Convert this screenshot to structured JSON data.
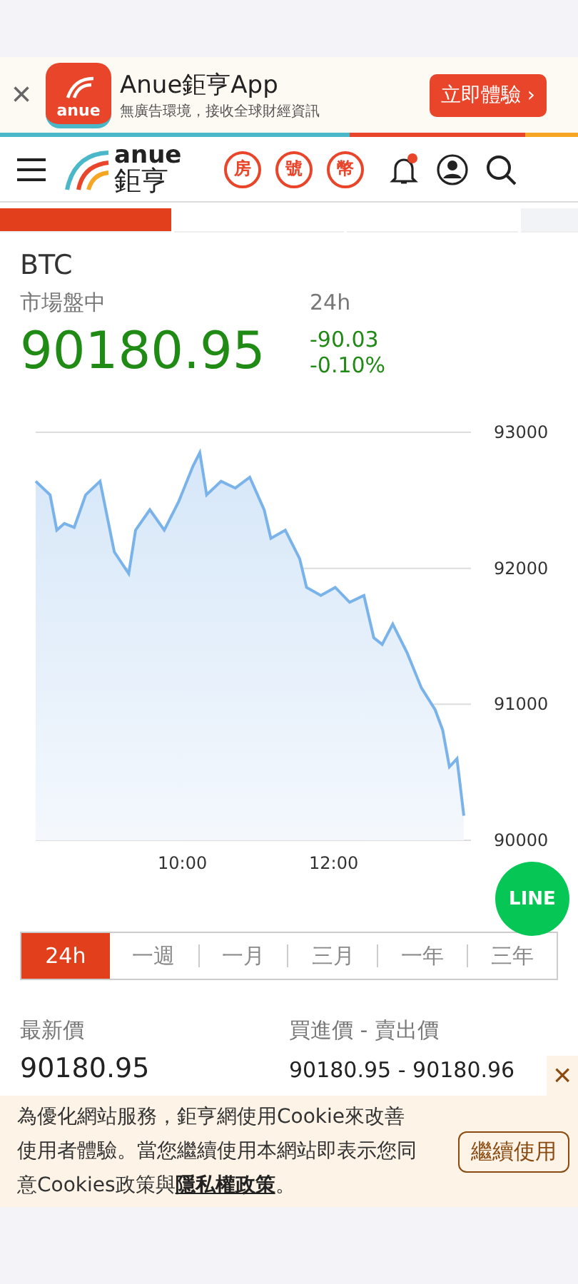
{
  "app_banner": {
    "icon_text": "anue",
    "title": "Anue鉅亨App",
    "subtitle": "無廣告環境，接收全球財經資訊",
    "cta": "立即體驗",
    "cta_arrow": "›",
    "close": "×"
  },
  "header": {
    "logo_top": "anue",
    "logo_bottom": "鉅亨",
    "quick_links": [
      {
        "label": "房"
      },
      {
        "label": "號"
      },
      {
        "label": "幣"
      }
    ],
    "notification_dot": true
  },
  "section_tabs": [
    {
      "selected": true
    },
    {
      "selected": false
    },
    {
      "selected": false
    },
    {
      "selected": false
    }
  ],
  "quote": {
    "symbol": "BTC",
    "status": "市場盤中",
    "period": "24h",
    "price": "90180.95",
    "change": "-90.03",
    "change_pct": "-0.10%"
  },
  "chart": {
    "chart_data": {
      "type": "area",
      "x": [
        8.06,
        8.25,
        8.34,
        8.44,
        8.57,
        8.72,
        8.91,
        9.1,
        9.29,
        9.38,
        9.57,
        9.76,
        9.95,
        10.14,
        10.23,
        10.32,
        10.51,
        10.7,
        10.89,
        11.08,
        11.17,
        11.36,
        11.55,
        11.64,
        11.83,
        12.02,
        12.21,
        12.4,
        12.53,
        12.64,
        12.78,
        12.97,
        13.16,
        13.34,
        13.44,
        13.53,
        13.63,
        13.72
      ],
      "series": [
        {
          "color": "#7ab3ea",
          "values": [
            92640,
            92540,
            92280,
            92330,
            92300,
            92540,
            92640,
            92120,
            91960,
            92280,
            92430,
            92280,
            92490,
            92750,
            92850,
            92540,
            92640,
            92590,
            92670,
            92430,
            92220,
            92280,
            92070,
            91860,
            91800,
            91860,
            91750,
            91800,
            91490,
            91440,
            91590,
            91380,
            91120,
            90960,
            90810,
            90540,
            90600,
            90180
          ]
        }
      ],
      "xlim": [
        8.06,
        13.72
      ],
      "ylim": [
        90000,
        93000
      ],
      "xticks": [
        {
          "value": 10,
          "label": "10:00"
        },
        {
          "value": 12,
          "label": "12:00"
        }
      ],
      "yticks": [
        90000,
        91000,
        92000,
        93000
      ]
    }
  },
  "range_tabs": [
    {
      "label": "24h",
      "selected": true
    },
    {
      "label": "一週",
      "selected": false
    },
    {
      "label": "一月",
      "selected": false
    },
    {
      "label": "三月",
      "selected": false
    },
    {
      "label": "一年",
      "selected": false
    },
    {
      "label": "三年",
      "selected": false
    }
  ],
  "line_button": {
    "label": "LINE"
  },
  "stats": [
    {
      "label": "最新價",
      "value": "90180.95"
    },
    {
      "label": "買進價 - 賣出價",
      "value": "90180.95 - 90180.96"
    }
  ],
  "cookie_notice": {
    "text": "為優化網站服務，鉅亨網使用Cookie來改善使用者體驗。當您繼續使用本網站即表示您同意Cookies政策與",
    "link": "隱私權政策",
    "end": "。",
    "button": "繼續使用",
    "close": "×"
  }
}
